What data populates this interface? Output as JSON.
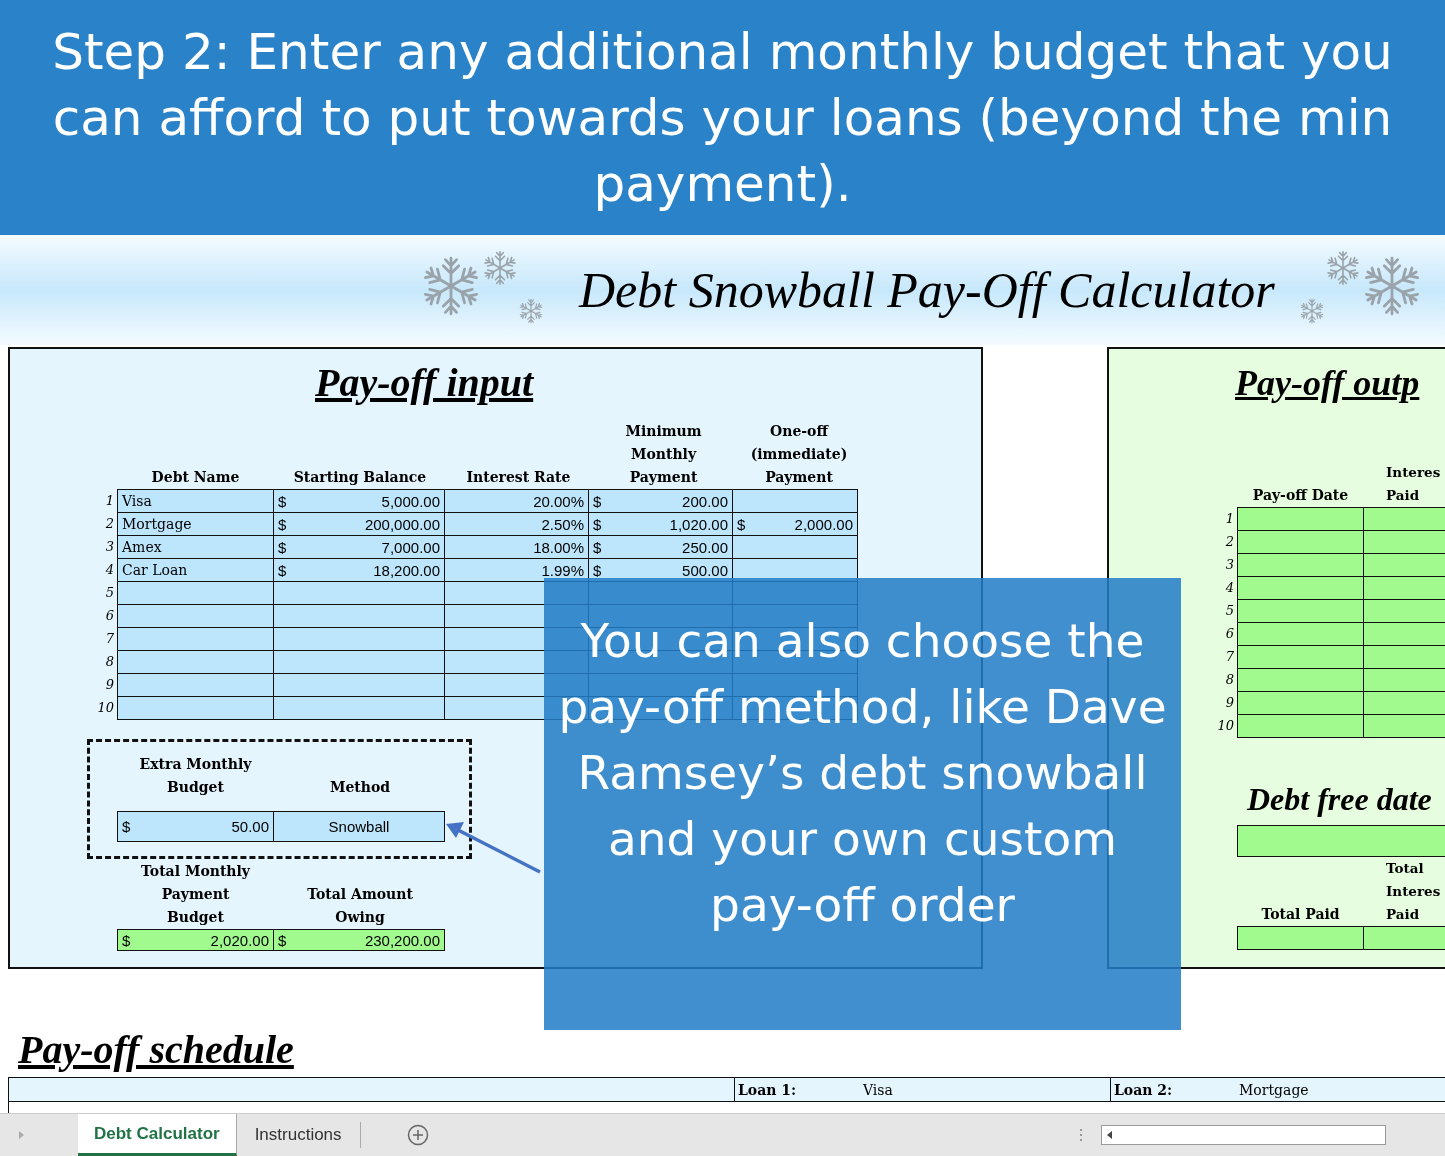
{
  "header_banner": {
    "text": "Step 2: Enter any additional monthly budget that you can afford to put towards your loans (beyond the min payment)."
  },
  "sheet_title": "Debt Snowball Pay-Off Calculator",
  "input_panel": {
    "title": "Pay-off input",
    "columns": [
      "Debt Name",
      "Starting Balance",
      "Interest Rate",
      "Minimum\nMonthly\nPayment",
      "One-off\n(immediate)\nPayment"
    ],
    "rows": [
      {
        "number": "1",
        "name": "Visa",
        "balance": "5,000.00",
        "rate": "20.00%",
        "min_payment": "200.00"
      },
      {
        "number": "2",
        "name": "Mortgage",
        "balance": "200,000.00",
        "rate": "2.50%",
        "min_payment": "1,020.00",
        "one_off": "2,000.00"
      },
      {
        "number": "3",
        "name": "Amex",
        "balance": "7,000.00",
        "rate": "18.00%",
        "min_payment": "250.00"
      },
      {
        "number": "4",
        "name": "Car Loan",
        "balance": "18,200.00",
        "rate": "1.99%",
        "min_payment": "500.00"
      },
      {
        "number": "5"
      },
      {
        "number": "6"
      },
      {
        "number": "7"
      },
      {
        "number": "8"
      },
      {
        "number": "9"
      },
      {
        "number": "10"
      }
    ],
    "currency": "$",
    "extra_budget": {
      "label": "Extra Monthly\nBudget",
      "value": "50.00"
    },
    "method": {
      "label": "Method",
      "value": "Snowball"
    },
    "total_monthly": {
      "label": "Total Monthly\nPayment\nBudget",
      "value": "2,020.00"
    },
    "total_owing": {
      "label": "Total Amount\nOwing",
      "value": "230,200.00"
    }
  },
  "output_panel": {
    "title": "Pay-off outp",
    "columns": [
      "Pay-off Date",
      "Interes\nPaid"
    ],
    "row_numbers": [
      "1",
      "2",
      "3",
      "4",
      "5",
      "6",
      "7",
      "8",
      "9",
      "10"
    ],
    "debt_free_title": "Debt free date",
    "total_columns": [
      "Total Paid",
      "Total\nInteres\nPaid"
    ]
  },
  "callout": {
    "text": "You can also choose the pay-off method, like Dave Ramsey’s debt snowball and your own custom pay-off order"
  },
  "schedule": {
    "title": "Pay-off schedule",
    "loans": [
      {
        "label": "Loan 1:",
        "name": "Visa"
      },
      {
        "label": "Loan 2:",
        "name": "Mortgage"
      }
    ]
  },
  "sheet_tabs": [
    {
      "label": "Debt Calculator",
      "selected": true
    },
    {
      "label": "Instructions",
      "selected": false
    }
  ]
}
